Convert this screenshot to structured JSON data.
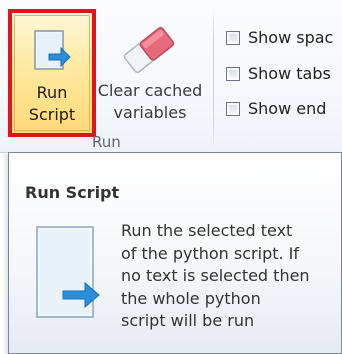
{
  "ribbon": {
    "run_button": {
      "line1": "Run",
      "line2": "Script",
      "icon": "run-script-icon"
    },
    "clear_button": {
      "line1": "Clear cached",
      "line2": "variables",
      "icon": "eraser-icon"
    },
    "group_label": "Run",
    "checkboxes": [
      {
        "label": "Show spac",
        "checked": false
      },
      {
        "label": "Show tabs",
        "checked": false
      },
      {
        "label": "Show end",
        "checked": false
      }
    ]
  },
  "tooltip": {
    "title": "Run Script",
    "icon": "run-script-icon",
    "description_lines": [
      "Run the selected text",
      "of the python script. If",
      "no text is selected then",
      "the whole python",
      "script will be run"
    ]
  },
  "colors": {
    "highlight_border": "#e0151b",
    "button_hover": "#ffe9a0",
    "arrow_blue": "#2a8fdb"
  }
}
